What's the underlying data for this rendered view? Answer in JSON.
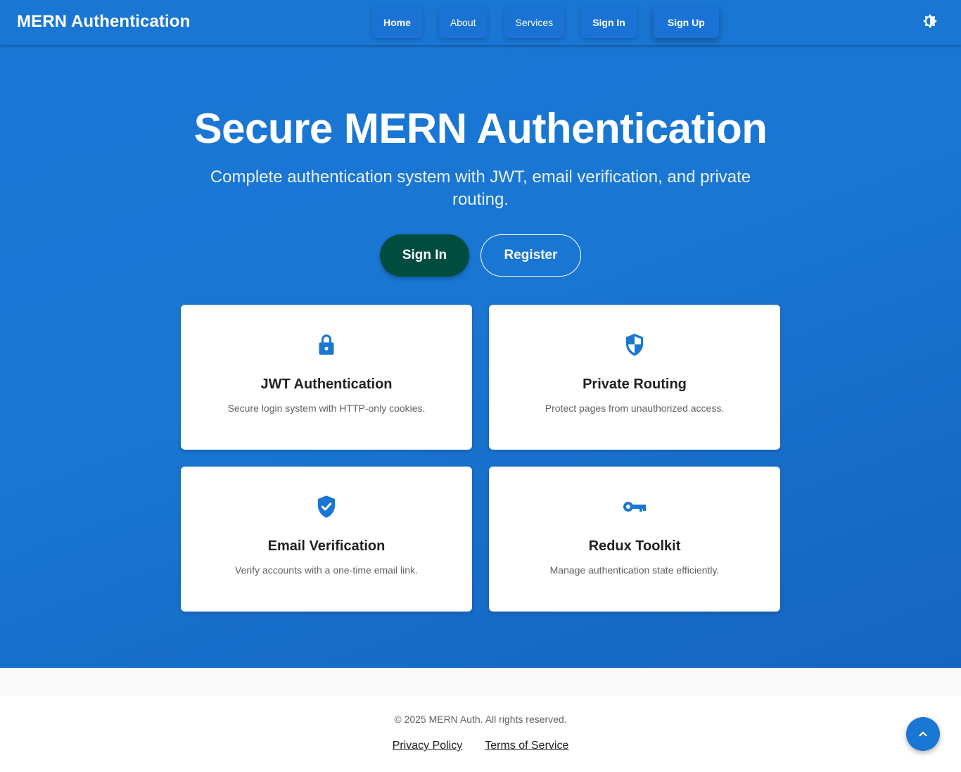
{
  "appbar": {
    "brand": "MERN Authentication",
    "nav": [
      {
        "label": "Home"
      },
      {
        "label": "About"
      },
      {
        "label": "Services"
      },
      {
        "label": "Sign In"
      },
      {
        "label": "Sign Up"
      }
    ],
    "theme_toggle_icon": "brightness-icon"
  },
  "hero": {
    "title": "Secure MERN Authentication",
    "subtitle": "Complete authentication system with JWT, email verification, and private routing.",
    "primary_button": "Sign In",
    "secondary_button": "Register"
  },
  "features": [
    {
      "icon": "lock-icon",
      "title": "JWT Authentication",
      "text": "Secure login system with HTTP-only cookies."
    },
    {
      "icon": "shield-icon",
      "title": "Private Routing",
      "text": "Protect pages from unauthorized access."
    },
    {
      "icon": "verified-shield-icon",
      "title": "Email Verification",
      "text": "Verify accounts with a one-time email link."
    },
    {
      "icon": "key-icon",
      "title": "Redux Toolkit",
      "text": "Manage authentication state efficiently."
    }
  ],
  "footer": {
    "copyright": "© 2025 MERN Auth. All rights reserved.",
    "links": [
      {
        "label": "Privacy Policy"
      },
      {
        "label": "Terms of Service"
      }
    ],
    "scroll_top_icon": "chevron-up-icon"
  },
  "colors": {
    "primary": "#1976d2",
    "primary_dark": "#1565c0",
    "accent_button": "#004d40",
    "card_icon": "#1976d2"
  }
}
